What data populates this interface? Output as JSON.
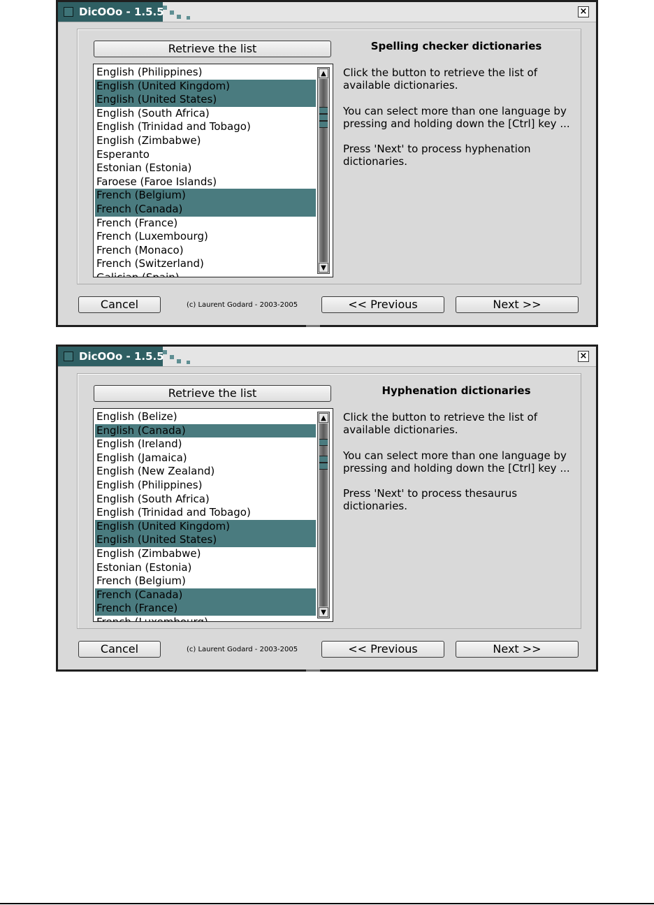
{
  "window1": {
    "title": "DicOOo - 1.5.5",
    "retrieve_label": "Retrieve the list",
    "section_title": "Spelling checker dictionaries",
    "para1": "Click the button to retrieve the list of available dictionaries.",
    "para2": "You can select more than one language by pressing and holding down  the [Ctrl] key ...",
    "para3": "Press 'Next' to process hyphenation dictionaries.",
    "items": [
      {
        "label": "English (Philippines)",
        "selected": false
      },
      {
        "label": "English (United Kingdom)",
        "selected": true
      },
      {
        "label": "English (United States)",
        "selected": true
      },
      {
        "label": "English (South Africa)",
        "selected": false
      },
      {
        "label": "English (Trinidad and Tobago)",
        "selected": false
      },
      {
        "label": "English (Zimbabwe)",
        "selected": false
      },
      {
        "label": "Esperanto",
        "selected": false
      },
      {
        "label": "Estonian (Estonia)",
        "selected": false
      },
      {
        "label": "Faroese (Faroe Islands)",
        "selected": false
      },
      {
        "label": "French (Belgium)",
        "selected": true
      },
      {
        "label": "French (Canada)",
        "selected": true
      },
      {
        "label": "French (France)",
        "selected": false
      },
      {
        "label": "French (Luxembourg)",
        "selected": false
      },
      {
        "label": "French (Monaco)",
        "selected": false
      },
      {
        "label": "French (Switzerland)",
        "selected": false
      },
      {
        "label": "Galician (Spain)",
        "selected": false
      }
    ],
    "cancel_label": "Cancel",
    "copyright": "(c) Laurent Godard - 2003-2005",
    "previous_label": "<< Previous",
    "next_label": "Next >>"
  },
  "window2": {
    "title": "DicOOo - 1.5.5",
    "retrieve_label": "Retrieve the list",
    "section_title": "Hyphenation dictionaries",
    "para1": "Click the button to retrieve the list of available dictionaries.",
    "para2": "You can select more than one language by pressing and holding down  the [Ctrl] key ...",
    "para3": "Press 'Next' to process thesaurus dictionaries.",
    "items": [
      {
        "label": "English (Belize)",
        "selected": false
      },
      {
        "label": "English (Canada)",
        "selected": true
      },
      {
        "label": "English (Ireland)",
        "selected": false
      },
      {
        "label": "English (Jamaica)",
        "selected": false
      },
      {
        "label": "English (New Zealand)",
        "selected": false
      },
      {
        "label": "English (Philippines)",
        "selected": false
      },
      {
        "label": "English (South Africa)",
        "selected": false
      },
      {
        "label": "English (Trinidad and Tobago)",
        "selected": false
      },
      {
        "label": "English (United Kingdom)",
        "selected": true
      },
      {
        "label": "English (United States)",
        "selected": true
      },
      {
        "label": "English (Zimbabwe)",
        "selected": false
      },
      {
        "label": "Estonian (Estonia)",
        "selected": false
      },
      {
        "label": "French (Belgium)",
        "selected": false
      },
      {
        "label": "French (Canada)",
        "selected": true
      },
      {
        "label": "French (France)",
        "selected": true
      },
      {
        "label": "French (Luxembourg)",
        "selected": false
      }
    ],
    "cancel_label": "Cancel",
    "copyright": "(c) Laurent Godard - 2003-2005",
    "previous_label": "<< Previous",
    "next_label": "Next >>"
  },
  "icons": {
    "window_menu": "window-menu-icon",
    "close": "close-icon",
    "scroll_up": "scroll-up-arrow-icon",
    "scroll_down": "scroll-down-arrow-icon"
  },
  "colors": {
    "title_bar": "#2f5f63",
    "selection": "#4a7b7f",
    "dialog_bg": "#d9d9d9"
  }
}
